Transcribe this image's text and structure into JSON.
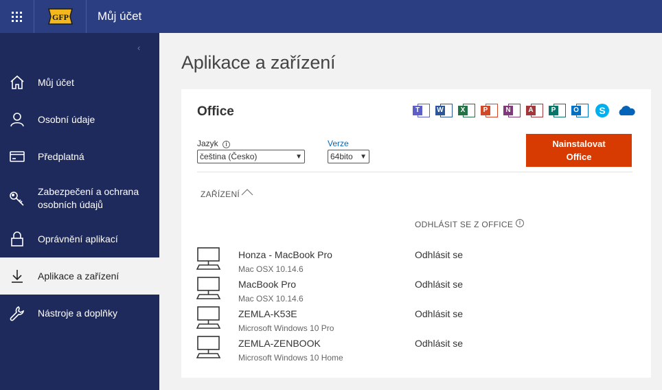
{
  "header": {
    "logo_text": "GFP",
    "title": "Můj účet"
  },
  "sidebar": {
    "items": [
      {
        "label": "Můj účet",
        "icon": "home-icon"
      },
      {
        "label": "Osobní údaje",
        "icon": "person-icon"
      },
      {
        "label": "Předplatná",
        "icon": "card-icon"
      },
      {
        "label1": "Zabezpečení a ochrana",
        "label2": "osobních údajů",
        "icon": "key-icon"
      },
      {
        "label": "Oprávnění aplikací",
        "icon": "lock-icon"
      },
      {
        "label": "Aplikace a zařízení",
        "icon": "download-icon",
        "active": true
      },
      {
        "label": "Nástroje a doplňky",
        "icon": "wrench-icon"
      }
    ]
  },
  "main": {
    "title": "Aplikace a zařízení",
    "office": {
      "title": "Office",
      "apps": [
        {
          "name": "teams",
          "letter": "T",
          "color": "#5b5fc7"
        },
        {
          "name": "word",
          "letter": "W",
          "color": "#2b579a"
        },
        {
          "name": "excel",
          "letter": "X",
          "color": "#217346"
        },
        {
          "name": "powerpoint",
          "letter": "P",
          "color": "#d24726"
        },
        {
          "name": "onenote",
          "letter": "N",
          "color": "#80397b"
        },
        {
          "name": "access",
          "letter": "A",
          "color": "#a4373a"
        },
        {
          "name": "publisher",
          "letter": "P",
          "color": "#077568"
        },
        {
          "name": "outlook",
          "letter": "O",
          "color": "#0072c6"
        },
        {
          "name": "skype",
          "letter": "S",
          "color": "#00aff0"
        },
        {
          "name": "onedrive",
          "letter": "",
          "color": "#0364b8"
        }
      ],
      "language_label": "Jazyk",
      "language_value": "čeština (Česko)",
      "version_label": "Verze",
      "version_value": "64bito",
      "install_line1": "Nainstalovat",
      "install_line2": "Office"
    },
    "devices": {
      "header": "ZAŘÍZENÍ",
      "signout_header": "ODHLÁSIT SE Z OFFICE",
      "signout_label": "Odhlásit se",
      "items": [
        {
          "name": "Honza - MacBook Pro",
          "os": "Mac OSX 10.14.6",
          "signout": "Odhlásit se"
        },
        {
          "name": "MacBook Pro",
          "os": "Mac OSX 10.14.6",
          "signout": "Odhlásit se"
        },
        {
          "name": "ZEMLA-K53E",
          "os": "Microsoft Windows 10 Pro",
          "signout": "Odhlásit se"
        },
        {
          "name": "ZEMLA-ZENBOOK",
          "os": "Microsoft Windows 10 Home",
          "signout": "Odhlásit se"
        }
      ]
    }
  },
  "colors": {
    "topbar": "#2c3e82",
    "sidebar": "#1f2a5c",
    "install": "#d83b01",
    "link": "#0067b8"
  }
}
